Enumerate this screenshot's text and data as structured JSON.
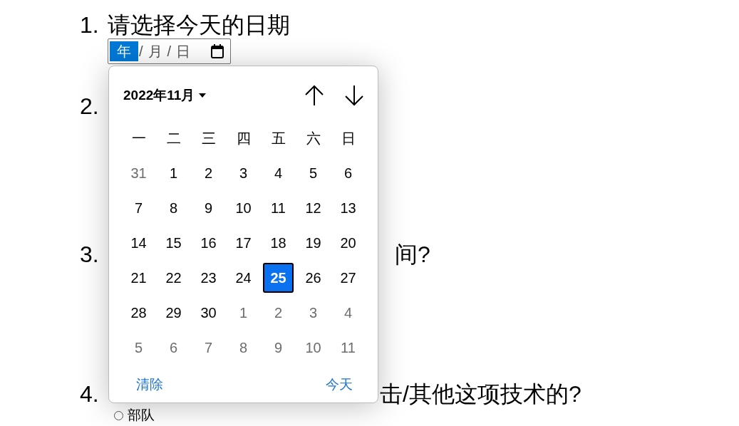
{
  "questions": [
    {
      "number": "1.",
      "text": "请选择今天的日期",
      "date_input": {
        "segments": [
          {
            "label": "年",
            "selected": true
          },
          {
            "label": "月",
            "selected": false
          },
          {
            "label": "日",
            "selected": false
          }
        ],
        "separators": [
          "/",
          "/"
        ]
      }
    },
    {
      "number": "2."
    },
    {
      "number": "3.",
      "text": "间?"
    },
    {
      "number": "4.",
      "text": "击/其他这项技术的?",
      "options": [
        {
          "label": "部队",
          "selected": false
        }
      ]
    }
  ],
  "date_picker": {
    "month_label": "2022年11月",
    "weekdays": [
      "一",
      "二",
      "三",
      "四",
      "五",
      "六",
      "日"
    ],
    "days": [
      {
        "label": "31",
        "other_month": true,
        "selected": false
      },
      {
        "label": "1",
        "other_month": false,
        "selected": false
      },
      {
        "label": "2",
        "other_month": false,
        "selected": false
      },
      {
        "label": "3",
        "other_month": false,
        "selected": false
      },
      {
        "label": "4",
        "other_month": false,
        "selected": false
      },
      {
        "label": "5",
        "other_month": false,
        "selected": false
      },
      {
        "label": "6",
        "other_month": false,
        "selected": false
      },
      {
        "label": "7",
        "other_month": false,
        "selected": false
      },
      {
        "label": "8",
        "other_month": false,
        "selected": false
      },
      {
        "label": "9",
        "other_month": false,
        "selected": false
      },
      {
        "label": "10",
        "other_month": false,
        "selected": false
      },
      {
        "label": "11",
        "other_month": false,
        "selected": false
      },
      {
        "label": "12",
        "other_month": false,
        "selected": false
      },
      {
        "label": "13",
        "other_month": false,
        "selected": false
      },
      {
        "label": "14",
        "other_month": false,
        "selected": false
      },
      {
        "label": "15",
        "other_month": false,
        "selected": false
      },
      {
        "label": "16",
        "other_month": false,
        "selected": false
      },
      {
        "label": "17",
        "other_month": false,
        "selected": false
      },
      {
        "label": "18",
        "other_month": false,
        "selected": false
      },
      {
        "label": "19",
        "other_month": false,
        "selected": false
      },
      {
        "label": "20",
        "other_month": false,
        "selected": false
      },
      {
        "label": "21",
        "other_month": false,
        "selected": false
      },
      {
        "label": "22",
        "other_month": false,
        "selected": false
      },
      {
        "label": "23",
        "other_month": false,
        "selected": false
      },
      {
        "label": "24",
        "other_month": false,
        "selected": false
      },
      {
        "label": "25",
        "other_month": false,
        "selected": true
      },
      {
        "label": "26",
        "other_month": false,
        "selected": false
      },
      {
        "label": "27",
        "other_month": false,
        "selected": false
      },
      {
        "label": "28",
        "other_month": false,
        "selected": false
      },
      {
        "label": "29",
        "other_month": false,
        "selected": false
      },
      {
        "label": "30",
        "other_month": false,
        "selected": false
      },
      {
        "label": "1",
        "other_month": true,
        "selected": false
      },
      {
        "label": "2",
        "other_month": true,
        "selected": false
      },
      {
        "label": "3",
        "other_month": true,
        "selected": false
      },
      {
        "label": "4",
        "other_month": true,
        "selected": false
      },
      {
        "label": "5",
        "other_month": true,
        "selected": false
      },
      {
        "label": "6",
        "other_month": true,
        "selected": false
      },
      {
        "label": "7",
        "other_month": true,
        "selected": false
      },
      {
        "label": "8",
        "other_month": true,
        "selected": false
      },
      {
        "label": "9",
        "other_month": true,
        "selected": false
      },
      {
        "label": "10",
        "other_month": true,
        "selected": false
      },
      {
        "label": "11",
        "other_month": true,
        "selected": false
      }
    ],
    "clear_button": "清除",
    "today_button": "今天"
  }
}
